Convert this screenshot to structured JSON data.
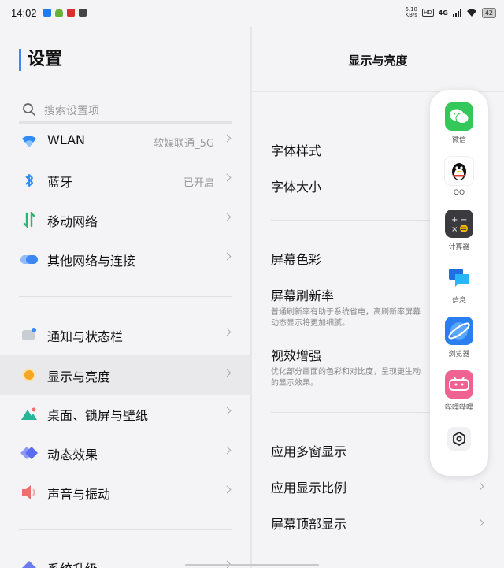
{
  "status_bar": {
    "time": "14:02",
    "app_icons": [
      {
        "name": "notif-app-icon",
        "color": "#1e7cf2"
      },
      {
        "name": "android-icon",
        "color": "#67b338"
      },
      {
        "name": "notif-red-icon",
        "color": "#d9302c"
      },
      {
        "name": "play-store-icon",
        "color": "#444444"
      }
    ],
    "net_speed_value": "6.10",
    "net_speed_unit": "KB/s",
    "hd_label": "HD",
    "network_label": "4G",
    "battery": "42"
  },
  "left": {
    "title": "设置",
    "search_placeholder": "搜索设置项",
    "items": [
      {
        "name": "wlan",
        "label": "WLAN",
        "value": "软媒联通_5G",
        "icon": "wifi-icon",
        "color": "#2f8cf5"
      },
      {
        "name": "bluetooth",
        "label": "蓝牙",
        "value": "已开启",
        "icon": "bluetooth-icon",
        "color": "#2f8cf5"
      },
      {
        "name": "mobile-network",
        "label": "移动网络",
        "value": "",
        "icon": "mobile-data-icon",
        "color": "#2bb673"
      },
      {
        "name": "other-network",
        "label": "其他网络与连接",
        "value": "",
        "icon": "connection-icon",
        "color": "#3c86f5"
      },
      {
        "name": "notifications",
        "label": "通知与状态栏",
        "value": "",
        "icon": "notification-icon",
        "color": "#9aa3b0"
      },
      {
        "name": "display",
        "label": "显示与亮度",
        "value": "",
        "icon": "brightness-icon",
        "color": "#f5a623"
      },
      {
        "name": "desktop",
        "label": "桌面、锁屏与壁纸",
        "value": "",
        "icon": "wallpaper-icon",
        "color": "#27b59a"
      },
      {
        "name": "animations",
        "label": "动态效果",
        "value": "",
        "icon": "animation-icon",
        "color": "#5b6cf0"
      },
      {
        "name": "sound",
        "label": "声音与振动",
        "value": "",
        "icon": "sound-icon",
        "color": "#f26d6d"
      },
      {
        "name": "system-update",
        "label": "系统升级",
        "value": "",
        "icon": "update-icon",
        "color": "#6b7cf0"
      }
    ],
    "selected": "display"
  },
  "right": {
    "title": "显示与亮度",
    "items": [
      {
        "name": "font-style",
        "label": "字体样式",
        "desc": ""
      },
      {
        "name": "font-size",
        "label": "字体大小",
        "desc": ""
      },
      {
        "name": "screen-color",
        "label": "屏幕色彩",
        "desc": ""
      },
      {
        "name": "refresh-rate",
        "label": "屏幕刷新率",
        "desc": "普通刷新率有助于系统省电，高刷新率屏幕动态显示将更加细腻。"
      },
      {
        "name": "visual-enhance",
        "label": "视效增强",
        "desc": "优化部分画面的色彩和对比度，呈现更生动的显示效果。"
      },
      {
        "name": "multi-window",
        "label": "应用多窗显示",
        "desc": ""
      },
      {
        "name": "aspect-ratio",
        "label": "应用显示比例",
        "desc": ""
      },
      {
        "name": "top-display",
        "label": "屏幕顶部显示",
        "desc": ""
      }
    ]
  },
  "dock": {
    "apps": [
      {
        "name": "wechat",
        "label": "微信",
        "icon": "wechat-icon",
        "color": "#34c759"
      },
      {
        "name": "qq",
        "label": "QQ",
        "icon": "qq-penguin-icon",
        "color": "#ffffff"
      },
      {
        "name": "calculator",
        "label": "计算器",
        "icon": "calculator-icon",
        "color": "#3b3b3f"
      },
      {
        "name": "messages",
        "label": "信息",
        "icon": "messages-icon",
        "color": "#ffffff"
      },
      {
        "name": "browser",
        "label": "浏览器",
        "icon": "browser-icon",
        "color": "#2a7ef0"
      },
      {
        "name": "bilibili",
        "label": "哔哩哔哩",
        "icon": "bilibili-icon",
        "color": "#f06292"
      }
    ],
    "settings_icon": "dock-settings-icon"
  }
}
